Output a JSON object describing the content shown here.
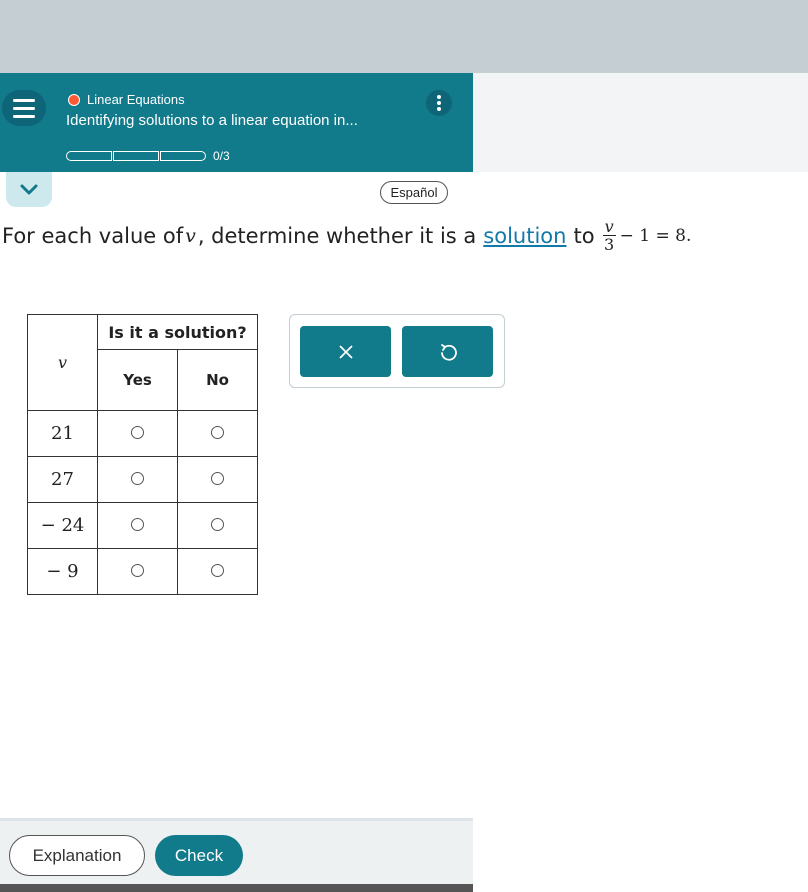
{
  "header": {
    "topic": "Linear Equations",
    "title": "Identifying solutions to a linear equation in...",
    "progress_text": "0/3",
    "progress_segments": 3,
    "progress_completed": 0
  },
  "language_button": "Español",
  "question": {
    "prefix": "For each value of",
    "variable": "v",
    "middle": ", determine whether it is a",
    "link": "solution",
    "to": "to",
    "equation_numerator": "v",
    "equation_denominator": "3",
    "equation_rest": "− 1 = 8."
  },
  "table": {
    "header_var": "v",
    "header_group": "Is it a solution?",
    "header_yes": "Yes",
    "header_no": "No",
    "rows": [
      "21",
      "27",
      "− 24",
      "− 9"
    ]
  },
  "buttons": {
    "explanation": "Explanation",
    "check": "Check"
  },
  "colors": {
    "teal": "#117a8b",
    "topic_dot": "#ff5a36",
    "link": "#1279a8"
  }
}
